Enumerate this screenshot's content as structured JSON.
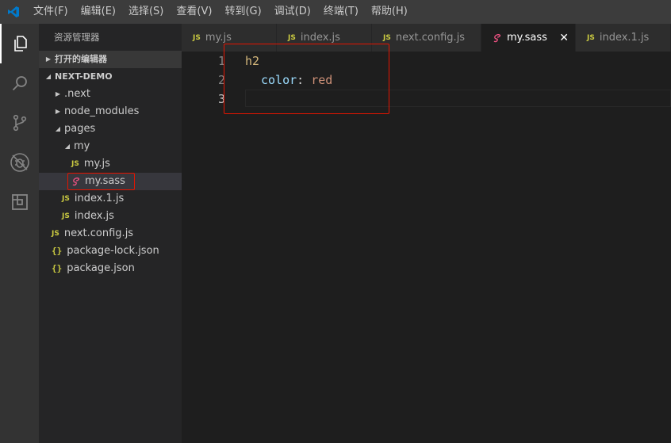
{
  "menu": [
    "文件(F)",
    "编辑(E)",
    "选择(S)",
    "查看(V)",
    "转到(G)",
    "调试(D)",
    "终端(T)",
    "帮助(H)"
  ],
  "sidebar": {
    "title": "资源管理器",
    "open_editors": "打开的编辑器",
    "project": "NEXT-DEMO",
    "tree": {
      "next": ".next",
      "node_modules": "node_modules",
      "pages": "pages",
      "my": "my",
      "my_js": "my.js",
      "my_sass": "my.sass",
      "index1_js": "index.1.js",
      "index_js": "index.js",
      "next_config": "next.config.js",
      "package_lock": "package-lock.json",
      "package_json": "package.json"
    }
  },
  "badges": {
    "js": "JS",
    "json": "{}"
  },
  "tabs": [
    "my.js",
    "index.js",
    "next.config.js",
    "my.sass",
    "index.1.js"
  ],
  "active_tab": "my.sass",
  "editor": {
    "line_numbers": [
      "1",
      "2",
      "3"
    ],
    "line1": "h2",
    "line2_prop": "color",
    "line2_colon": ": ",
    "line2_value": "red"
  },
  "colors": {
    "accent_js": "#cbcb41",
    "sass_icon": "#f55385",
    "highlight": "#e51400",
    "vscode_blue": "#007acc"
  }
}
